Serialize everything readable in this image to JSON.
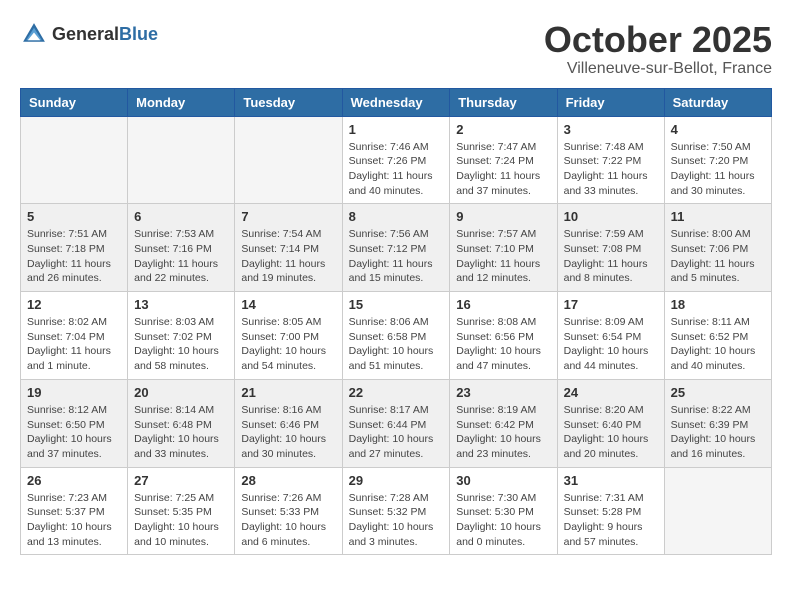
{
  "header": {
    "logo_general": "General",
    "logo_blue": "Blue",
    "month_title": "October 2025",
    "location": "Villeneuve-sur-Bellot, France"
  },
  "weekdays": [
    "Sunday",
    "Monday",
    "Tuesday",
    "Wednesday",
    "Thursday",
    "Friday",
    "Saturday"
  ],
  "weeks": [
    [
      {
        "day": "",
        "info": ""
      },
      {
        "day": "",
        "info": ""
      },
      {
        "day": "",
        "info": ""
      },
      {
        "day": "1",
        "info": "Sunrise: 7:46 AM\nSunset: 7:26 PM\nDaylight: 11 hours\nand 40 minutes."
      },
      {
        "day": "2",
        "info": "Sunrise: 7:47 AM\nSunset: 7:24 PM\nDaylight: 11 hours\nand 37 minutes."
      },
      {
        "day": "3",
        "info": "Sunrise: 7:48 AM\nSunset: 7:22 PM\nDaylight: 11 hours\nand 33 minutes."
      },
      {
        "day": "4",
        "info": "Sunrise: 7:50 AM\nSunset: 7:20 PM\nDaylight: 11 hours\nand 30 minutes."
      }
    ],
    [
      {
        "day": "5",
        "info": "Sunrise: 7:51 AM\nSunset: 7:18 PM\nDaylight: 11 hours\nand 26 minutes."
      },
      {
        "day": "6",
        "info": "Sunrise: 7:53 AM\nSunset: 7:16 PM\nDaylight: 11 hours\nand 22 minutes."
      },
      {
        "day": "7",
        "info": "Sunrise: 7:54 AM\nSunset: 7:14 PM\nDaylight: 11 hours\nand 19 minutes."
      },
      {
        "day": "8",
        "info": "Sunrise: 7:56 AM\nSunset: 7:12 PM\nDaylight: 11 hours\nand 15 minutes."
      },
      {
        "day": "9",
        "info": "Sunrise: 7:57 AM\nSunset: 7:10 PM\nDaylight: 11 hours\nand 12 minutes."
      },
      {
        "day": "10",
        "info": "Sunrise: 7:59 AM\nSunset: 7:08 PM\nDaylight: 11 hours\nand 8 minutes."
      },
      {
        "day": "11",
        "info": "Sunrise: 8:00 AM\nSunset: 7:06 PM\nDaylight: 11 hours\nand 5 minutes."
      }
    ],
    [
      {
        "day": "12",
        "info": "Sunrise: 8:02 AM\nSunset: 7:04 PM\nDaylight: 11 hours\nand 1 minute."
      },
      {
        "day": "13",
        "info": "Sunrise: 8:03 AM\nSunset: 7:02 PM\nDaylight: 10 hours\nand 58 minutes."
      },
      {
        "day": "14",
        "info": "Sunrise: 8:05 AM\nSunset: 7:00 PM\nDaylight: 10 hours\nand 54 minutes."
      },
      {
        "day": "15",
        "info": "Sunrise: 8:06 AM\nSunset: 6:58 PM\nDaylight: 10 hours\nand 51 minutes."
      },
      {
        "day": "16",
        "info": "Sunrise: 8:08 AM\nSunset: 6:56 PM\nDaylight: 10 hours\nand 47 minutes."
      },
      {
        "day": "17",
        "info": "Sunrise: 8:09 AM\nSunset: 6:54 PM\nDaylight: 10 hours\nand 44 minutes."
      },
      {
        "day": "18",
        "info": "Sunrise: 8:11 AM\nSunset: 6:52 PM\nDaylight: 10 hours\nand 40 minutes."
      }
    ],
    [
      {
        "day": "19",
        "info": "Sunrise: 8:12 AM\nSunset: 6:50 PM\nDaylight: 10 hours\nand 37 minutes."
      },
      {
        "day": "20",
        "info": "Sunrise: 8:14 AM\nSunset: 6:48 PM\nDaylight: 10 hours\nand 33 minutes."
      },
      {
        "day": "21",
        "info": "Sunrise: 8:16 AM\nSunset: 6:46 PM\nDaylight: 10 hours\nand 30 minutes."
      },
      {
        "day": "22",
        "info": "Sunrise: 8:17 AM\nSunset: 6:44 PM\nDaylight: 10 hours\nand 27 minutes."
      },
      {
        "day": "23",
        "info": "Sunrise: 8:19 AM\nSunset: 6:42 PM\nDaylight: 10 hours\nand 23 minutes."
      },
      {
        "day": "24",
        "info": "Sunrise: 8:20 AM\nSunset: 6:40 PM\nDaylight: 10 hours\nand 20 minutes."
      },
      {
        "day": "25",
        "info": "Sunrise: 8:22 AM\nSunset: 6:39 PM\nDaylight: 10 hours\nand 16 minutes."
      }
    ],
    [
      {
        "day": "26",
        "info": "Sunrise: 7:23 AM\nSunset: 5:37 PM\nDaylight: 10 hours\nand 13 minutes."
      },
      {
        "day": "27",
        "info": "Sunrise: 7:25 AM\nSunset: 5:35 PM\nDaylight: 10 hours\nand 10 minutes."
      },
      {
        "day": "28",
        "info": "Sunrise: 7:26 AM\nSunset: 5:33 PM\nDaylight: 10 hours\nand 6 minutes."
      },
      {
        "day": "29",
        "info": "Sunrise: 7:28 AM\nSunset: 5:32 PM\nDaylight: 10 hours\nand 3 minutes."
      },
      {
        "day": "30",
        "info": "Sunrise: 7:30 AM\nSunset: 5:30 PM\nDaylight: 10 hours\nand 0 minutes."
      },
      {
        "day": "31",
        "info": "Sunrise: 7:31 AM\nSunset: 5:28 PM\nDaylight: 9 hours\nand 57 minutes."
      },
      {
        "day": "",
        "info": ""
      }
    ]
  ]
}
